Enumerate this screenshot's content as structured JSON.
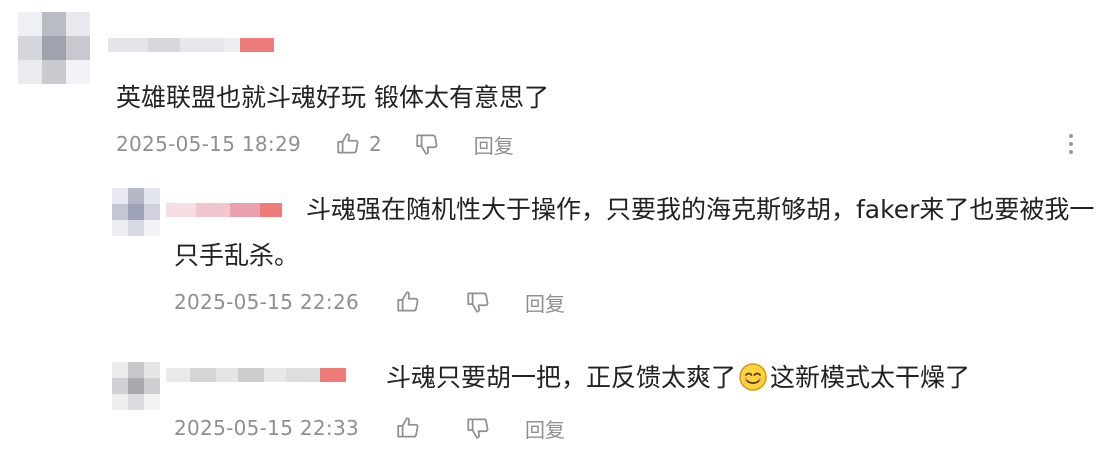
{
  "comments": [
    {
      "text": "英雄联盟也就斗魂好玩 锻体太有意思了",
      "time": "2025-05-15 18:29",
      "likes": "2",
      "reply_label": "回复"
    },
    {
      "text_line1": "斗魂强在随机性大于操作，只要我的海克斯够胡，faker来了也要被我一",
      "text_line2": "只手乱杀。",
      "time": "2025-05-15 22:26",
      "reply_label": "回复"
    },
    {
      "text_before_emoji": "斗魂只要胡一把，正反馈太爽了",
      "text_after_emoji": "这新模式太干燥了",
      "time": "2025-05-15 22:33",
      "reply_label": "回复"
    }
  ],
  "icons": {
    "like": "thumbs-up-icon",
    "dislike": "thumbs-down-icon",
    "more": "more-vertical-icon",
    "emoji": "smiling-face-icon"
  },
  "colors": {
    "meta_text": "#8f8f8f",
    "body_text": "#222222",
    "name_accent": "#f07b7b"
  }
}
